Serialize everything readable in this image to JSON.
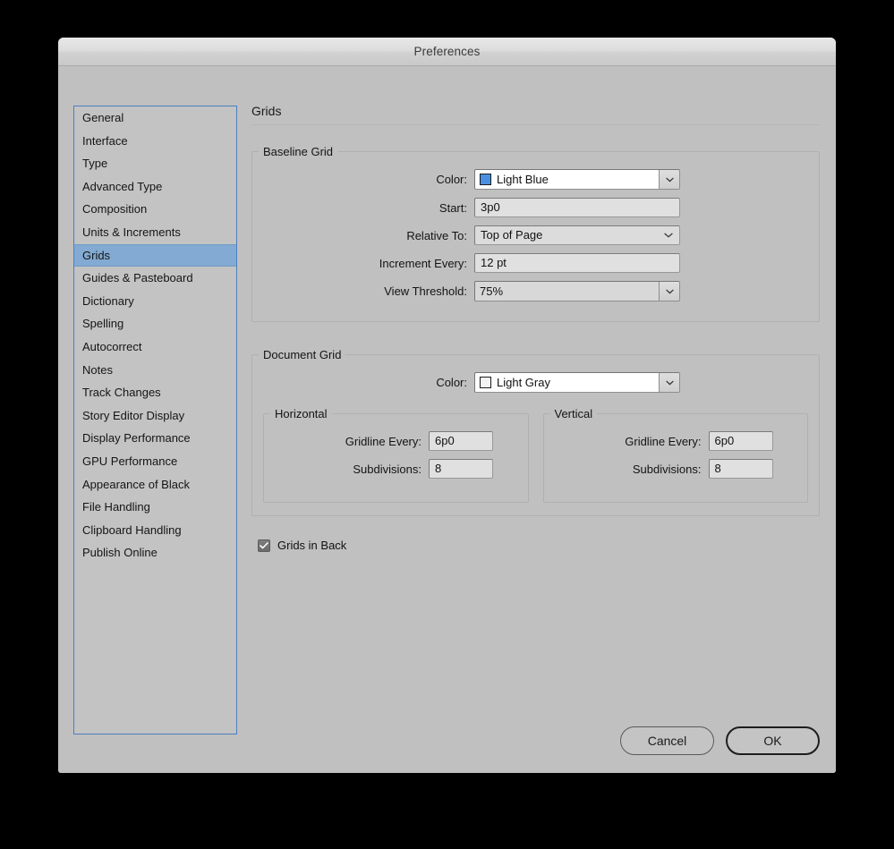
{
  "window": {
    "title": "Preferences"
  },
  "sidebar": {
    "items": [
      {
        "label": "General",
        "selected": false
      },
      {
        "label": "Interface",
        "selected": false
      },
      {
        "label": "Type",
        "selected": false
      },
      {
        "label": "Advanced Type",
        "selected": false
      },
      {
        "label": "Composition",
        "selected": false
      },
      {
        "label": "Units & Increments",
        "selected": false
      },
      {
        "label": "Grids",
        "selected": true
      },
      {
        "label": "Guides & Pasteboard",
        "selected": false
      },
      {
        "label": "Dictionary",
        "selected": false
      },
      {
        "label": "Spelling",
        "selected": false
      },
      {
        "label": "Autocorrect",
        "selected": false
      },
      {
        "label": "Notes",
        "selected": false
      },
      {
        "label": "Track Changes",
        "selected": false
      },
      {
        "label": "Story Editor Display",
        "selected": false
      },
      {
        "label": "Display Performance",
        "selected": false
      },
      {
        "label": "GPU Performance",
        "selected": false
      },
      {
        "label": "Appearance of Black",
        "selected": false
      },
      {
        "label": "File Handling",
        "selected": false
      },
      {
        "label": "Clipboard Handling",
        "selected": false
      },
      {
        "label": "Publish Online",
        "selected": false
      }
    ]
  },
  "panel": {
    "title": "Grids",
    "baseline_grid": {
      "legend": "Baseline Grid",
      "color_label": "Color:",
      "color_value": "Light Blue",
      "color_swatch": "#4a90e2",
      "start_label": "Start:",
      "start_value": "3p0",
      "relative_to_label": "Relative To:",
      "relative_to_value": "Top of Page",
      "increment_label": "Increment Every:",
      "increment_value": "12 pt",
      "view_threshold_label": "View Threshold:",
      "view_threshold_value": "75%"
    },
    "document_grid": {
      "legend": "Document Grid",
      "color_label": "Color:",
      "color_value": "Light Gray",
      "color_swatch": "#f2f2f2",
      "horizontal": {
        "legend": "Horizontal",
        "gridline_label": "Gridline Every:",
        "gridline_value": "6p0",
        "subdivisions_label": "Subdivisions:",
        "subdivisions_value": "8"
      },
      "vertical": {
        "legend": "Vertical",
        "gridline_label": "Gridline Every:",
        "gridline_value": "6p0",
        "subdivisions_label": "Subdivisions:",
        "subdivisions_value": "8"
      }
    },
    "grids_in_back": {
      "label": "Grids in Back",
      "checked": true
    }
  },
  "footer": {
    "cancel_label": "Cancel",
    "ok_label": "OK"
  }
}
